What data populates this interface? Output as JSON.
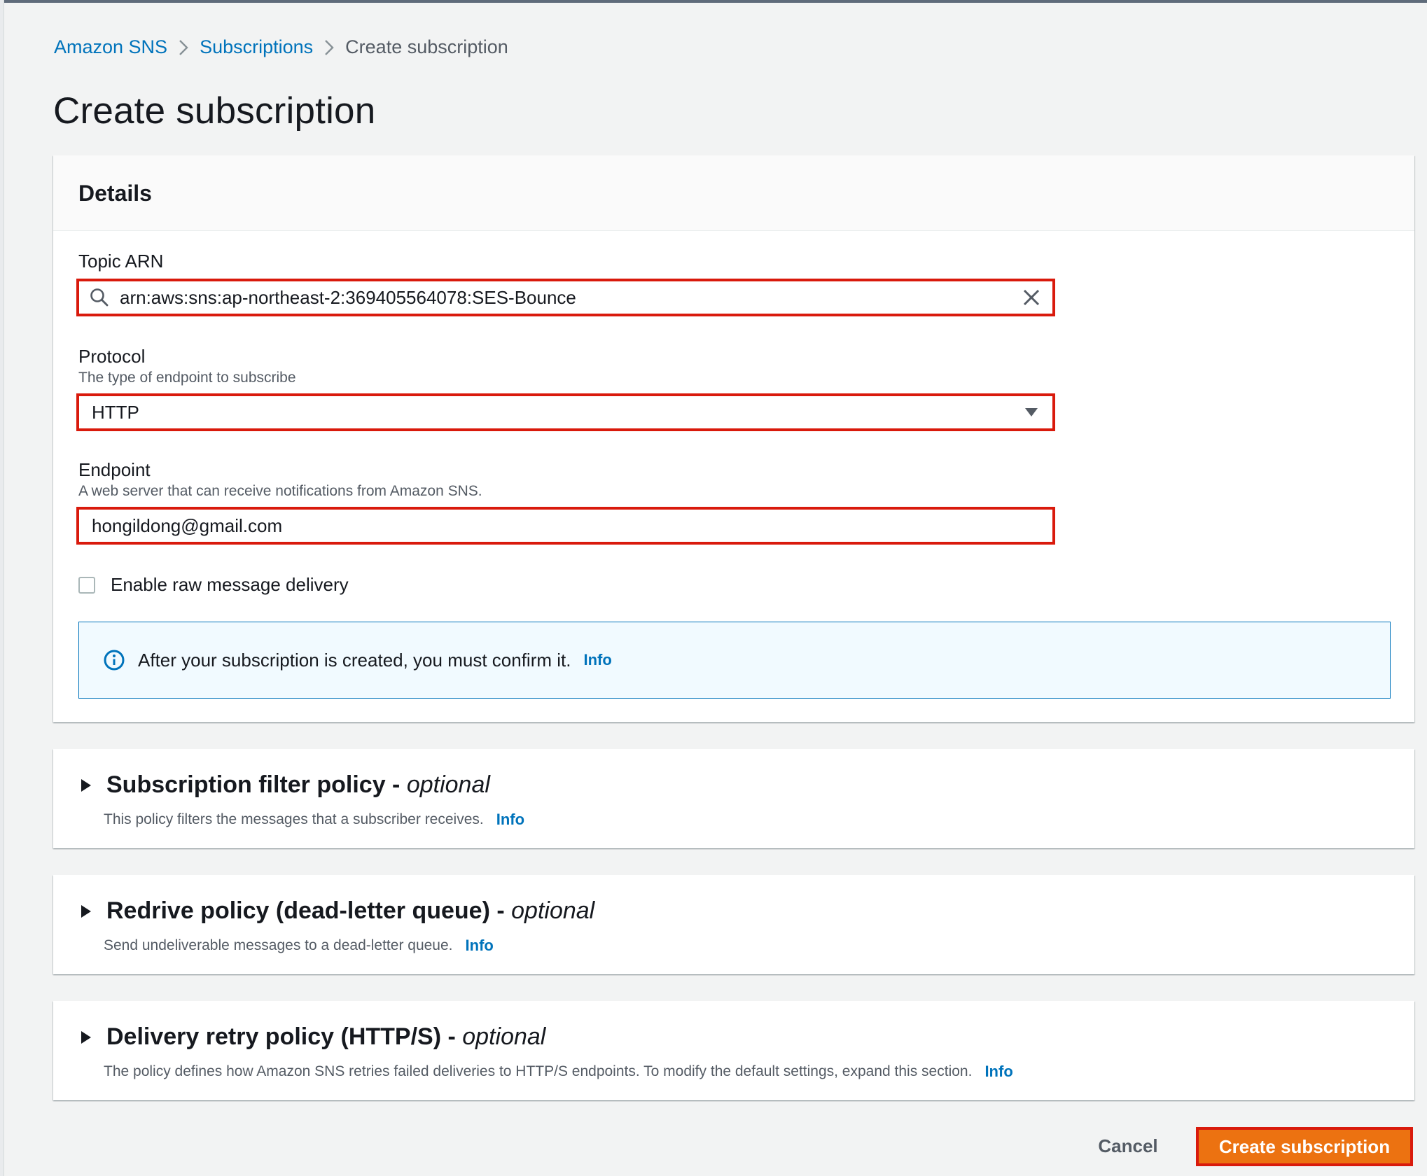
{
  "breadcrumb": {
    "items": [
      "Amazon SNS",
      "Subscriptions"
    ],
    "current": "Create subscription"
  },
  "page": {
    "title": "Create subscription"
  },
  "details": {
    "heading": "Details",
    "topic_arn": {
      "label": "Topic ARN",
      "value": "arn:aws:sns:ap-northeast-2:369405564078:SES-Bounce"
    },
    "protocol": {
      "label": "Protocol",
      "description": "The type of endpoint to subscribe",
      "value": "HTTP"
    },
    "endpoint": {
      "label": "Endpoint",
      "description": "A web server that can receive notifications from Amazon SNS.",
      "value": "hongildong@gmail.com"
    },
    "raw_delivery": {
      "label": "Enable raw message delivery",
      "checked": false
    },
    "alert": {
      "text": "After your subscription is created, you must confirm it.",
      "info": "Info"
    }
  },
  "sections": [
    {
      "title": "Subscription filter policy - ",
      "optional": "optional",
      "description": "This policy filters the messages that a subscriber receives.",
      "info": "Info"
    },
    {
      "title": "Redrive policy (dead-letter queue) - ",
      "optional": "optional",
      "description": "Send undeliverable messages to a dead-letter queue.",
      "info": "Info"
    },
    {
      "title": "Delivery retry policy (HTTP/S) - ",
      "optional": "optional",
      "description": "The policy defines how Amazon SNS retries failed deliveries to HTTP/S endpoints. To modify the default settings, expand this section.",
      "info": "Info"
    }
  ],
  "actions": {
    "cancel": "Cancel",
    "submit": "Create subscription"
  },
  "colors": {
    "link": "#0073bb",
    "primary": "#ec7211",
    "highlight": "#d91a0c"
  }
}
